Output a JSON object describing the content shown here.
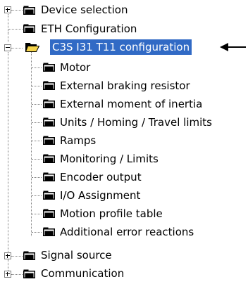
{
  "tree": {
    "nodes": [
      {
        "label": "Device selection",
        "expander": "plus"
      },
      {
        "label": "ETH Configuration",
        "expander": "none"
      },
      {
        "label": "C3S I31 T11 configuration",
        "expander": "minus",
        "selected": true,
        "open": true
      },
      {
        "label": "Motor"
      },
      {
        "label": "External braking resistor"
      },
      {
        "label": "External moment of inertia"
      },
      {
        "label": "Units / Homing / Travel limits"
      },
      {
        "label": "Ramps"
      },
      {
        "label": "Monitoring / Limits"
      },
      {
        "label": "Encoder output"
      },
      {
        "label": "I/O Assignment"
      },
      {
        "label": "Motion profile table"
      },
      {
        "label": "Additional error reactions"
      },
      {
        "label": "Signal source",
        "expander": "plus"
      },
      {
        "label": "Communication",
        "expander": "plus"
      }
    ]
  },
  "annotation": {
    "arrow_icon": "left-arrow-icon",
    "arrow_color": "#000000"
  },
  "colors": {
    "selection_background": "#316ac5",
    "selection_text": "#ffffff",
    "folder_fill": "#000000",
    "open_folder_fill": "#f5d44b",
    "tree_lines": "#808080"
  }
}
